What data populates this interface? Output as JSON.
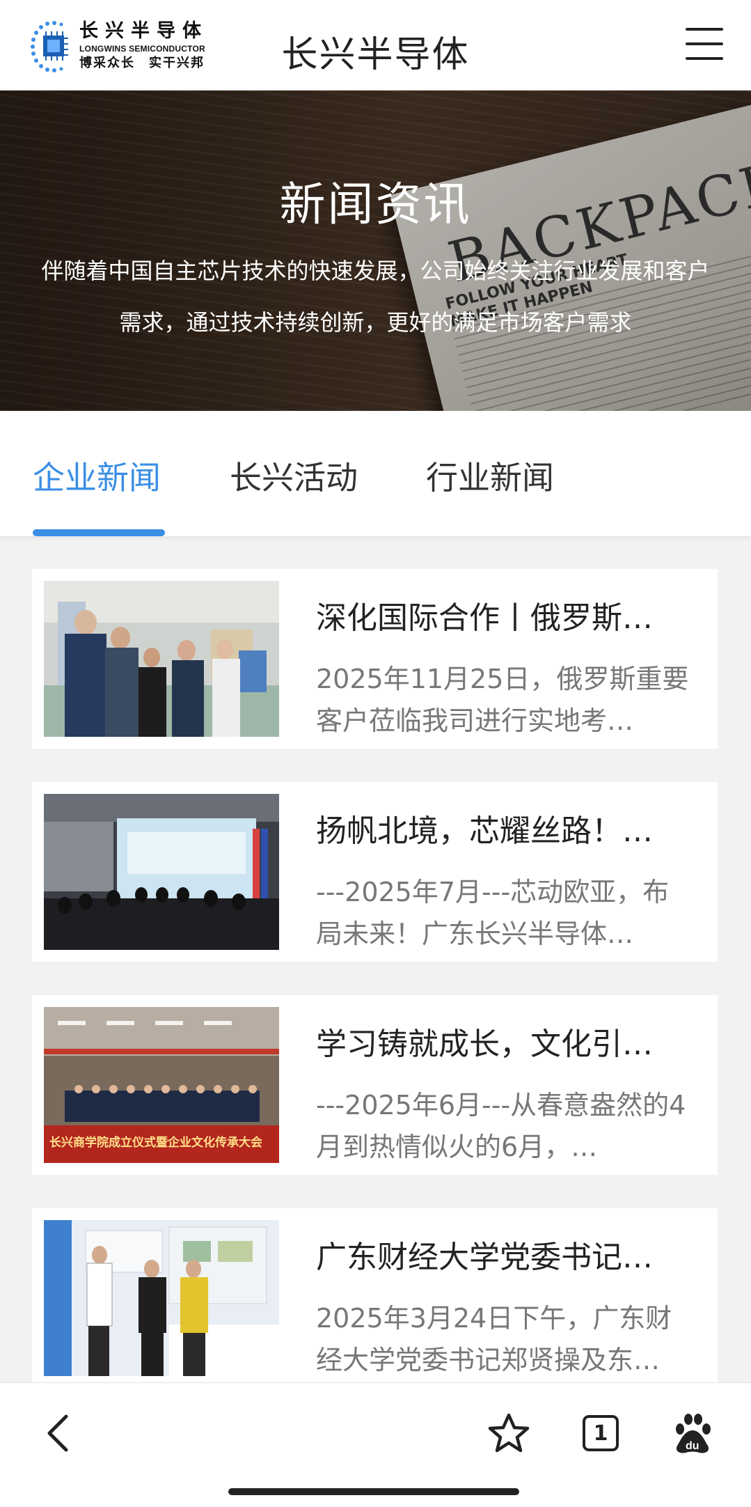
{
  "header": {
    "logo_cn": "长兴半导体",
    "logo_en": "LONGWINS SEMICONDUCTOR",
    "logo_slogan": "博采众长　实干兴邦",
    "site_title": "长兴半导体",
    "menu_icon": "hamburger-menu-icon"
  },
  "banner": {
    "title": "新闻资讯",
    "description": "伴随着中国自主芯片技术的快速发展，公司始终关注行业发展和客户需求，通过技术持续创新，更好的满足市场客户需求",
    "newspaper_headline": "BACKPACKER",
    "newspaper_small": "FOLLOW YOUR HEART\nMAKE IT HAPPEN"
  },
  "tabs": [
    {
      "label": "企业新闻",
      "active": true
    },
    {
      "label": "长兴活动",
      "active": false
    },
    {
      "label": "行业新闻",
      "active": false
    }
  ],
  "news": [
    {
      "title": "深化国际合作丨俄罗斯…",
      "summary": "2025年11月25日，俄罗斯重要客户莅临我司进行实地考…",
      "thumb": "visit-factory-photo"
    },
    {
      "title": "扬帆北境，芯耀丝路！…",
      "summary": "---2025年7月---芯动欧亚，布局未来！广东长兴半导体…",
      "thumb": "exhibition-opening-photo"
    },
    {
      "title": "学习铸就成长，文化引…",
      "summary": "---2025年6月---从春意盎然的4月到热情似火的6月，…",
      "thumb": "business-school-ceremony-photo",
      "banner_text": "长兴商学院成立仪式暨企业文化传承大会"
    },
    {
      "title": "广东财经大学党委书记…",
      "summary": "2025年3月24日下午，广东财经大学党委书记郑贤操及东…",
      "thumb": "university-visit-photo"
    }
  ],
  "bottom_bar": {
    "back_icon": "back-arrow-icon",
    "favorite_icon": "star-icon",
    "tabs_count": "1",
    "baidu_icon": "baidu-paw-icon"
  },
  "colors": {
    "accent": "#3a8ee6",
    "text_primary": "#222222",
    "text_secondary": "#777777",
    "background": "#f2f2f2"
  }
}
